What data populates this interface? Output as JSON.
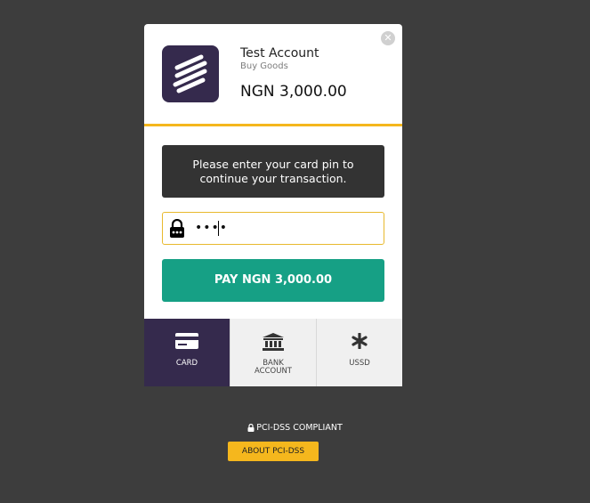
{
  "modal": {
    "close_icon": "close-icon"
  },
  "merchant": {
    "name": "Test Account",
    "subtitle": "Buy Goods",
    "amount": "NGN 3,000.00",
    "logo_icon": "stripes-logo-icon",
    "accent_color": "#f5b71d",
    "logo_bg": "#352a4d"
  },
  "notice": {
    "line1": "Please enter your card pin to",
    "line2": "continue your transaction."
  },
  "pin": {
    "value": "••••",
    "icon": "lock-icon"
  },
  "pay_button": {
    "label": "PAY NGN 3,000.00",
    "color": "#16a085"
  },
  "tabs": [
    {
      "label": "CARD",
      "icon": "credit-card-icon",
      "active": true
    },
    {
      "label": "BANK ACCOUNT",
      "icon": "bank-icon",
      "active": false
    },
    {
      "label": "USSD",
      "icon": "asterisk-icon",
      "active": false
    }
  ],
  "footer": {
    "compliance": "PCI-DSS COMPLIANT",
    "about_button": "ABOUT PCI-DSS"
  }
}
